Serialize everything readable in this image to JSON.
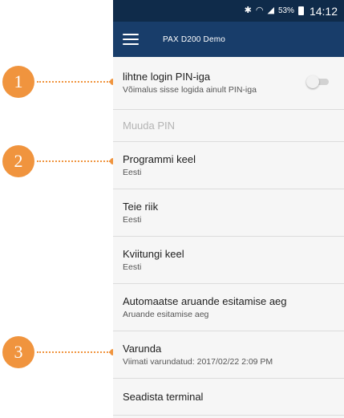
{
  "callouts": [
    {
      "number": "1"
    },
    {
      "number": "2"
    },
    {
      "number": "3"
    }
  ],
  "status_bar": {
    "bluetooth_icon": "bluetooth-icon",
    "wifi_icon": "wifi-icon",
    "signal_icon": "signal-icon",
    "battery_percent": "53%",
    "time": "14:12"
  },
  "app_bar": {
    "title": "PAX D200 Demo"
  },
  "settings": {
    "pin_login": {
      "title": "lihtne login PIN-iga",
      "subtitle": "Võimalus sisse logida ainult PIN-iga",
      "enabled": false
    },
    "change_pin": {
      "title": "Muuda PIN"
    },
    "program_language": {
      "title": "Programmi keel",
      "value": "Eesti"
    },
    "country": {
      "title": "Teie riik",
      "value": "Eesti"
    },
    "receipt_language": {
      "title": "Kviitungi keel",
      "value": "Eesti"
    },
    "auto_report": {
      "title": "Automaatse aruande esitamise aeg",
      "value": "Aruande esitamise aeg"
    },
    "backup": {
      "title": "Varunda",
      "value": "Viimati varundatud: 2017/02/22 2:09 PM"
    },
    "configure_terminal": {
      "title": "Seadista terminal"
    }
  }
}
